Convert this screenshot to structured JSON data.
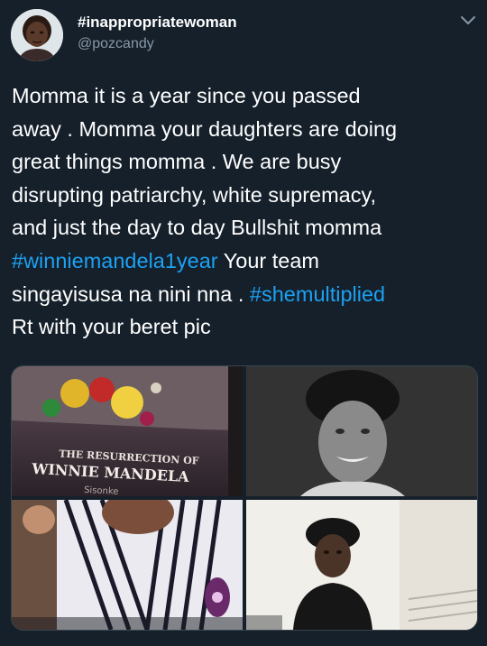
{
  "user": {
    "display_name": "#inappropriatewoman",
    "handle": "@pozcandy"
  },
  "tweet": {
    "lines": [
      [
        {
          "text": "Momma it is a year since you passed"
        }
      ],
      [
        {
          "text": "away . Momma your daughters are doing"
        }
      ],
      [
        {
          "text": "great things momma . We are busy"
        }
      ],
      [
        {
          "text": "disrupting patriarchy, white supremacy,"
        }
      ],
      [
        {
          "text": "and just the day to day Bullshit momma"
        }
      ],
      [
        {
          "text": "#winniemandela1year",
          "hashtag": true
        },
        {
          "text": " Your team"
        }
      ],
      [
        {
          "text": "singayisusa na nini nna . "
        },
        {
          "text": "#shemultiplied",
          "hashtag": true
        }
      ],
      [
        {
          "text": "Rt with your beret pic"
        }
      ]
    ]
  },
  "media": {
    "book_cover": {
      "title_line1": "THE RESURRECTION OF",
      "title_line2": "WINNIE MANDELA",
      "author_partial": "Sisonke"
    }
  },
  "icons": {
    "menu": "chevron-down-icon"
  },
  "colors": {
    "background": "#15202b",
    "hashtag": "#1da1f2",
    "secondary_text": "#8899a6"
  }
}
